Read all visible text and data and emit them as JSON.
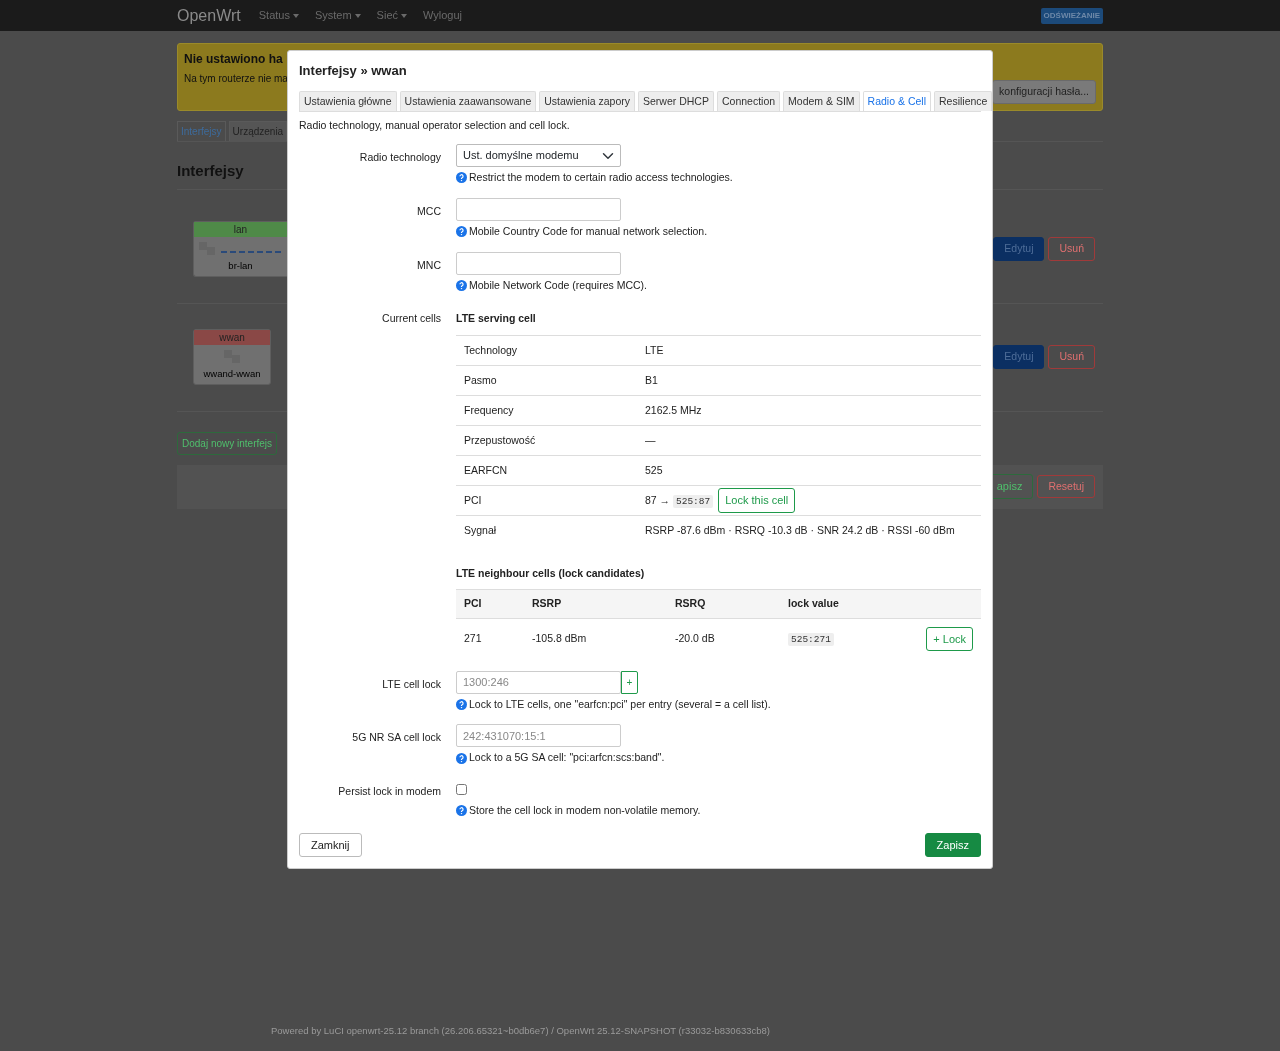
{
  "navbar": {
    "brand": "OpenWrt",
    "menu": [
      {
        "label": "Status",
        "dropdown": true
      },
      {
        "label": "System",
        "dropdown": true
      },
      {
        "label": "Sieć",
        "dropdown": true
      },
      {
        "label": "Wyloguj",
        "dropdown": false
      }
    ],
    "badge": "ODŚWIEŻANIE"
  },
  "page": {
    "warning": {
      "title": "Nie ustawiono ha",
      "text": "Na tym routerze nie ma",
      "button": "konfiguracji hasła..."
    },
    "tabs": [
      {
        "label": "Interfejsy",
        "selected": true
      },
      {
        "label": "Urządzenia",
        "selected": false
      }
    ],
    "heading": "Interfejsy",
    "interfaces": [
      {
        "name": "lan",
        "device": "br-lan",
        "color": "#4f8a48",
        "edit": "Edytuj",
        "delete": "Usuń"
      },
      {
        "name": "wwan",
        "device": "wwand-wwan",
        "color": "#8a4846",
        "edit": "Edytuj",
        "delete": "Usuń"
      }
    ],
    "add_button": "Dodaj nowy interfejs",
    "actions": [
      "apisz",
      "Resetuj"
    ]
  },
  "modal": {
    "title": "Interfejsy » wwan",
    "tabs": [
      {
        "label": "Ustawienia główne",
        "selected": false
      },
      {
        "label": "Ustawienia zaawansowane",
        "selected": false
      },
      {
        "label": "Ustawienia zapory",
        "selected": false
      },
      {
        "label": "Serwer DHCP",
        "selected": false
      },
      {
        "label": "Connection",
        "selected": false
      },
      {
        "label": "Modem & SIM",
        "selected": false
      },
      {
        "label": "Radio & Cell",
        "selected": true
      },
      {
        "label": "Resilience",
        "selected": false
      }
    ],
    "description": "Radio technology, manual operator selection and cell lock.",
    "fields": [
      {
        "kind": "select",
        "label": "Radio technology",
        "value": "Ust. domyślne modemu",
        "help": "Restrict the modem to certain radio access technologies."
      },
      {
        "kind": "text",
        "label": "MCC",
        "help": "Mobile Country Code for manual network selection."
      },
      {
        "kind": "text",
        "label": "MNC",
        "help": "Mobile Network Code (requires MCC)."
      },
      {
        "kind": "cells",
        "label": "Current cells",
        "serving": {
          "title": "LTE serving cell",
          "rows": [
            {
              "label": "Technology",
              "value": "LTE"
            },
            {
              "label": "Pasmo",
              "value": "B1"
            },
            {
              "label": "Frequency",
              "value": "2162.5 MHz"
            },
            {
              "label": "Przepustowość",
              "value": "—"
            },
            {
              "label": "EARFCN",
              "value": "525"
            },
            {
              "label": "PCI",
              "value": "87 →",
              "code": "525:87",
              "button": "Lock this cell"
            },
            {
              "label": "Sygnał",
              "value": "RSRP -87.6 dBm · RSRQ -10.3 dB · SNR 24.2 dB · RSSI -60 dBm"
            }
          ]
        },
        "neighbours": {
          "title": "LTE neighbour cells (lock candidates)",
          "columns": [
            "PCI",
            "RSRP",
            "RSRQ",
            "lock value"
          ],
          "rows": [
            {
              "cells": [
                "271",
                "-105.8 dBm",
                "-20.0 dB"
              ],
              "code": "525:271",
              "button": "+ Lock"
            }
          ]
        }
      },
      {
        "kind": "list",
        "label": "LTE cell lock",
        "placeholder": "1300:246",
        "add_button": "+",
        "help": "Lock to LTE cells, one \"earfcn:pci\" per entry (several = a cell list)."
      },
      {
        "kind": "text",
        "label": "5G NR SA cell lock",
        "placeholder": "242:431070:15:1",
        "help": "Lock to a 5G SA cell: \"pci:arfcn:scs:band\"."
      },
      {
        "kind": "checkbox",
        "label": "Persist lock in modem",
        "checked": false,
        "help": "Store the cell lock in modem non-volatile memory."
      }
    ],
    "buttons": {
      "close": "Zamknij",
      "save": "Zapisz"
    }
  },
  "footer": {
    "prefix": "Powered by",
    "link": "LuCI openwrt-25.12 branch (26.206.65321~b0db6e7) / OpenWrt 25.12-SNAPSHOT (r33032-b830633cb8)"
  }
}
